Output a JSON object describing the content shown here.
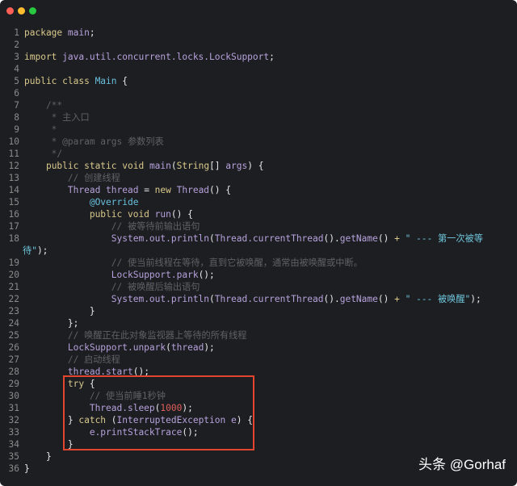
{
  "window": {
    "traffic_lights": {
      "close": "#fe5f57",
      "minimize": "#febc2e",
      "zoom": "#28c840"
    }
  },
  "highlight_color": "#e2462f",
  "watermark": "头条 @Gorhaf",
  "lines": [
    {
      "num": "1",
      "tokens": [
        [
          "k",
          "package"
        ],
        [
          "p",
          " "
        ],
        [
          "i",
          "main"
        ],
        [
          "p",
          ";"
        ]
      ]
    },
    {
      "num": "2",
      "tokens": []
    },
    {
      "num": "3",
      "tokens": [
        [
          "k",
          "import"
        ],
        [
          "p",
          " "
        ],
        [
          "i",
          "java.util.concurrent.locks.LockSupport"
        ],
        [
          "p",
          ";"
        ]
      ]
    },
    {
      "num": "4",
      "tokens": []
    },
    {
      "num": "5",
      "tokens": [
        [
          "k",
          "public class "
        ],
        [
          "t",
          "Main"
        ],
        [
          "p",
          " {"
        ]
      ]
    },
    {
      "num": "6",
      "tokens": []
    },
    {
      "num": "7",
      "tokens": [
        [
          "c",
          "    /**"
        ]
      ]
    },
    {
      "num": "8",
      "tokens": [
        [
          "c",
          "     * 主入口"
        ]
      ]
    },
    {
      "num": "9",
      "tokens": [
        [
          "c",
          "     *"
        ]
      ]
    },
    {
      "num": "10",
      "tokens": [
        [
          "c",
          "     * @param args 参数列表"
        ]
      ]
    },
    {
      "num": "11",
      "tokens": [
        [
          "c",
          "     */"
        ]
      ]
    },
    {
      "num": "12",
      "tokens": [
        [
          "p",
          "    "
        ],
        [
          "k",
          "public static void "
        ],
        [
          "i",
          "main"
        ],
        [
          "p",
          "("
        ],
        [
          "k",
          "String"
        ],
        [
          "p",
          "[] "
        ],
        [
          "i",
          "args"
        ],
        [
          "p",
          ") {"
        ]
      ]
    },
    {
      "num": "13",
      "tokens": [
        [
          "c",
          "        // 创建线程"
        ]
      ]
    },
    {
      "num": "14",
      "tokens": [
        [
          "p",
          "        "
        ],
        [
          "i",
          "Thread thread"
        ],
        [
          "p",
          " = "
        ],
        [
          "k",
          "new "
        ],
        [
          "i",
          "Thread"
        ],
        [
          "p",
          "() {"
        ]
      ]
    },
    {
      "num": "15",
      "tokens": [
        [
          "p",
          "            "
        ],
        [
          "t",
          "@Override"
        ]
      ]
    },
    {
      "num": "16",
      "tokens": [
        [
          "p",
          "            "
        ],
        [
          "k",
          "public void "
        ],
        [
          "i",
          "run"
        ],
        [
          "p",
          "() {"
        ]
      ]
    },
    {
      "num": "17",
      "tokens": [
        [
          "c",
          "                // 被等待前输出语句"
        ]
      ]
    },
    {
      "num": "18",
      "tokens": [
        [
          "p",
          "                "
        ],
        [
          "i",
          "System.out.println"
        ],
        [
          "p",
          "("
        ],
        [
          "i",
          "Thread.currentThread"
        ],
        [
          "p",
          "()."
        ],
        [
          "i",
          "getName"
        ],
        [
          "p",
          "() "
        ],
        [
          "k",
          "+"
        ],
        [
          "s",
          " \" --- 第一次被等"
        ]
      ]
    },
    {
      "num": "",
      "wrap": true,
      "tokens": [
        [
          "s",
          "待\""
        ],
        [
          "p",
          ");"
        ]
      ]
    },
    {
      "num": "19",
      "tokens": [
        [
          "c",
          "                // 使当前线程在等待，直到它被唤醒，通常由被唤醒或中断。"
        ]
      ]
    },
    {
      "num": "20",
      "tokens": [
        [
          "p",
          "                "
        ],
        [
          "i",
          "LockSupport.park"
        ],
        [
          "p",
          "();"
        ]
      ]
    },
    {
      "num": "21",
      "tokens": [
        [
          "c",
          "                // 被唤醒后输出语句"
        ]
      ]
    },
    {
      "num": "22",
      "tokens": [
        [
          "p",
          "                "
        ],
        [
          "i",
          "System.out.println"
        ],
        [
          "p",
          "("
        ],
        [
          "i",
          "Thread.currentThread"
        ],
        [
          "p",
          "()."
        ],
        [
          "i",
          "getName"
        ],
        [
          "p",
          "() "
        ],
        [
          "k",
          "+"
        ],
        [
          "s",
          " \" --- 被唤醒\""
        ],
        [
          "p",
          ");"
        ]
      ]
    },
    {
      "num": "23",
      "tokens": [
        [
          "p",
          "            }"
        ]
      ]
    },
    {
      "num": "24",
      "tokens": [
        [
          "p",
          "        };"
        ]
      ]
    },
    {
      "num": "25",
      "tokens": [
        [
          "c",
          "        // 唤醒正在此对象监视器上等待的所有线程"
        ]
      ]
    },
    {
      "num": "26",
      "tokens": [
        [
          "p",
          "        "
        ],
        [
          "i",
          "LockSupport.unpark"
        ],
        [
          "p",
          "("
        ],
        [
          "i",
          "thread"
        ],
        [
          "p",
          ");"
        ]
      ]
    },
    {
      "num": "27",
      "tokens": [
        [
          "c",
          "        // 启动线程"
        ]
      ]
    },
    {
      "num": "28",
      "tokens": [
        [
          "p",
          "        "
        ],
        [
          "i",
          "thread.start"
        ],
        [
          "p",
          "();"
        ]
      ]
    },
    {
      "num": "29",
      "tokens": [
        [
          "p",
          "        "
        ],
        [
          "k",
          "try"
        ],
        [
          "p",
          " {"
        ]
      ]
    },
    {
      "num": "30",
      "tokens": [
        [
          "c",
          "            // 使当前睡1秒钟"
        ]
      ]
    },
    {
      "num": "31",
      "tokens": [
        [
          "p",
          "            "
        ],
        [
          "i",
          "Thread.sleep"
        ],
        [
          "p",
          "("
        ],
        [
          "n",
          "1000"
        ],
        [
          "p",
          ");"
        ]
      ]
    },
    {
      "num": "32",
      "tokens": [
        [
          "p",
          "        } "
        ],
        [
          "k",
          "catch"
        ],
        [
          "p",
          " ("
        ],
        [
          "i",
          "InterruptedException e"
        ],
        [
          "p",
          ") {"
        ]
      ]
    },
    {
      "num": "33",
      "tokens": [
        [
          "p",
          "            "
        ],
        [
          "i",
          "e.printStackTrace"
        ],
        [
          "p",
          "();"
        ]
      ]
    },
    {
      "num": "34",
      "tokens": [
        [
          "p",
          "        }"
        ]
      ]
    },
    {
      "num": "35",
      "tokens": [
        [
          "p",
          "    }"
        ]
      ]
    },
    {
      "num": "36",
      "tokens": [
        [
          "p",
          "}"
        ]
      ]
    }
  ]
}
